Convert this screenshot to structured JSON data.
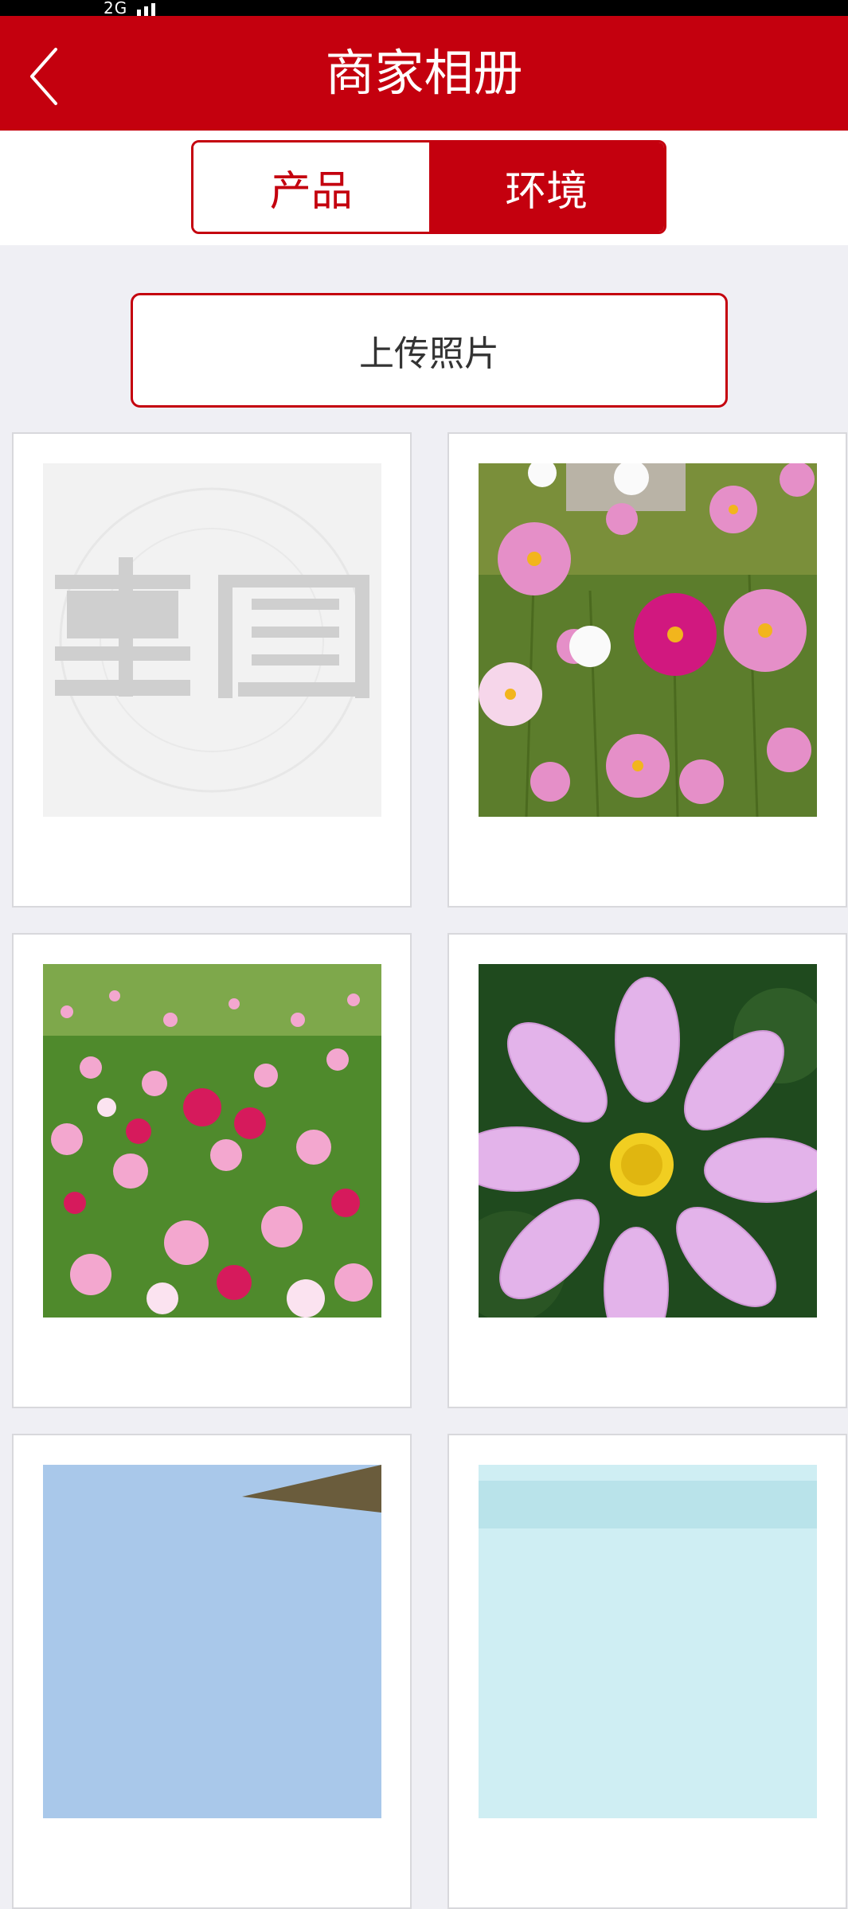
{
  "status_bar": {
    "network": "2G"
  },
  "header": {
    "title": "商家相册",
    "back_icon": "chevron-left-icon"
  },
  "tabs": [
    {
      "label": "产品",
      "active": false
    },
    {
      "label": "环境",
      "active": true
    }
  ],
  "upload_button": {
    "label": "上传照片"
  },
  "gallery": {
    "items": [
      {
        "image": "placeholder-logo",
        "watermark": "惠圈"
      },
      {
        "image": "cosmos-flowers-garden"
      },
      {
        "image": "cosmos-flower-field"
      },
      {
        "image": "pink-cosmos-closeup"
      },
      {
        "image": "sky-photo"
      },
      {
        "image": "sky-photo"
      }
    ]
  },
  "colors": {
    "brand_red": "#c4000e",
    "background": "#efeff4"
  }
}
